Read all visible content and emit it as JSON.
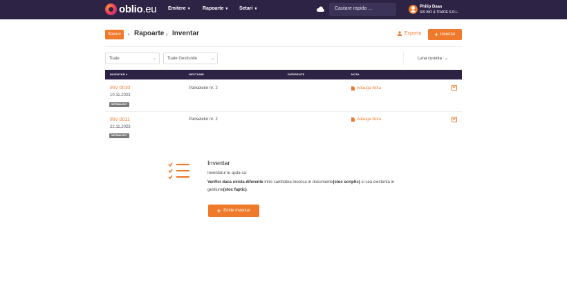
{
  "header": {
    "logo_main": "oblio",
    "logo_ext": ".eu",
    "nav": [
      "Emitere",
      "Rapoarte",
      "Setari"
    ],
    "search_placeholder": "Cautare rapida ...",
    "user_name": "Philip Daas",
    "user_company": "SIS BIO & TRADE S.R.L."
  },
  "breadcrumb": {
    "stocuri": "Stocuri",
    "rapoarte": "Rapoarte",
    "inventar": "Inventar"
  },
  "toolbar": {
    "export_label": "Exporta",
    "add_label": "Inventar"
  },
  "filters": {
    "status_value": "Toate",
    "gestiune_value": "Toate Gestiunile",
    "period_value": "Luna curenta"
  },
  "table": {
    "columns": [
      "INVENTAR #",
      "GESTIUNE",
      "DIFERENTE",
      "NOTA"
    ],
    "rows": [
      {
        "number": "INV 0010",
        "date": "10.11.2023",
        "status": "NEFINALIZAT",
        "gestiune": "Panselelor nr. 2",
        "note": "Adauga Nota"
      },
      {
        "number": "INV 0011",
        "date": "22.11.2023",
        "status": "NEFINALIZAT",
        "gestiune": "Panselelor nr. 2",
        "note": "Adauga Nota"
      }
    ]
  },
  "empty_state": {
    "title": "Inventar",
    "help": "Inventarul te ajuta sa:",
    "desc_bold1": "Verifici daca exista diferente",
    "desc_text1": " intre cantitatea inscrisa in documente",
    "desc_bold2": "(stoc scriptic)",
    "desc_text2": " si cea existenta in gestiune",
    "desc_bold3": "(stoc faptic)",
    "desc_text3": ".",
    "button_label": "Emite Inventar"
  },
  "colors": {
    "accent": "#f07a2b",
    "header_bg": "#2d2345"
  }
}
